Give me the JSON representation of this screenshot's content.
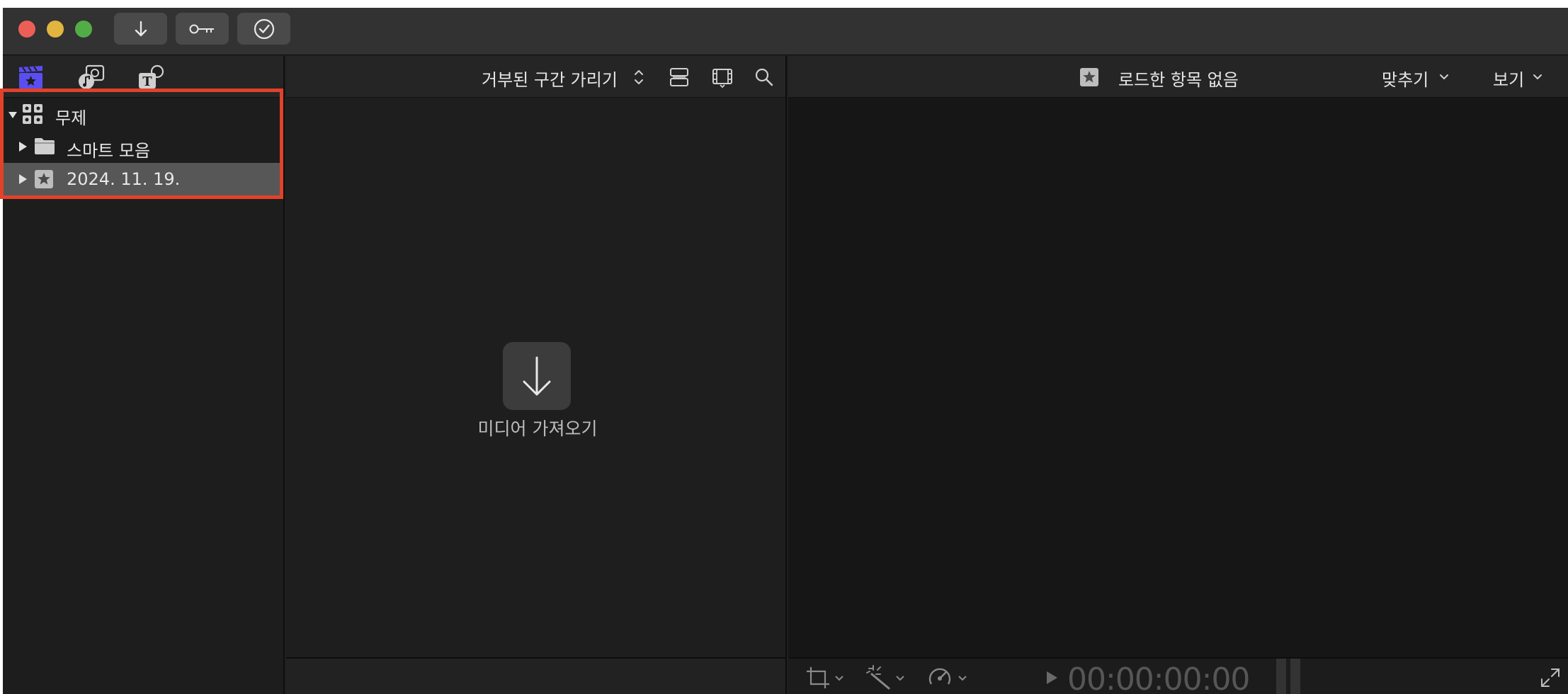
{
  "titlebar": {
    "buttons": [
      {
        "icon": "import-arrow-icon"
      },
      {
        "icon": "key-icon"
      },
      {
        "icon": "checkmark-circle-icon"
      }
    ]
  },
  "sidebar": {
    "tools": [
      {
        "icon": "clapper-star-icon",
        "active": true
      },
      {
        "icon": "photos-music-icon"
      },
      {
        "icon": "titles-generators-icon"
      }
    ],
    "library": {
      "name": "무제",
      "items": [
        {
          "label": "스마트 모음",
          "icon": "folder-icon"
        },
        {
          "label": "2024. 11. 19.",
          "icon": "event-star-icon",
          "selected": true
        }
      ]
    }
  },
  "browser": {
    "filter_label": "거부된 구간 가리기",
    "import_label": "미디어 가져오기"
  },
  "viewer": {
    "title": "로드한 항목 없음",
    "fit_label": "맞추기",
    "view_label": "보기",
    "timecode": "00:00:00:00"
  },
  "colors": {
    "accent": "#5a4ef0",
    "highlight_box": "#e2412a"
  }
}
